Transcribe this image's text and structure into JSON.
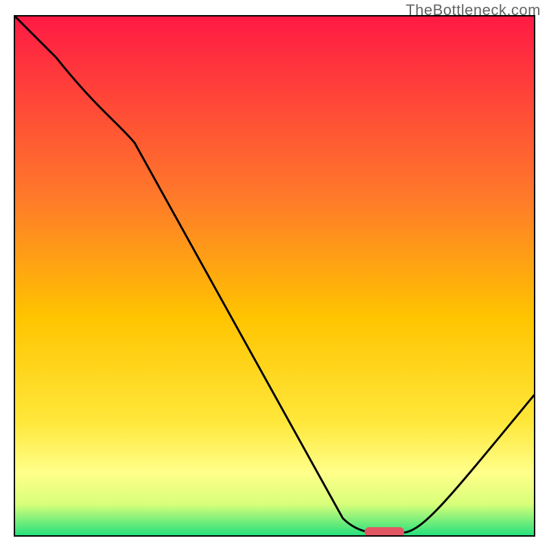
{
  "watermark": "TheBottleneck.com",
  "colors": {
    "frame": "#000000",
    "curve": "#000000",
    "marker": "#e25563",
    "grad_top": "#ff1a44",
    "grad_mid": "#ffd400",
    "grad_low": "#ffff8a",
    "grad_bottom": "#26e07c"
  },
  "chart_data": {
    "type": "line",
    "title": "",
    "xlabel": "",
    "ylabel": "",
    "xlim": [
      0,
      100
    ],
    "ylim": [
      0,
      100
    ],
    "grid": false,
    "legend": false,
    "annotations": [
      "TheBottleneck.com"
    ],
    "series": [
      {
        "name": "bottleneck-curve",
        "x": [
          0,
          20,
          62,
          70,
          75,
          100
        ],
        "values": [
          100,
          80,
          3,
          0.5,
          0.5,
          27
        ]
      }
    ],
    "marker": {
      "x_center": 72.5,
      "y": 0.5,
      "width": 6
    },
    "gradient_stops_percent_from_top": {
      "red": 0,
      "orange": 50,
      "yellow": 80,
      "pale_yellow": 88,
      "green": 100
    }
  }
}
